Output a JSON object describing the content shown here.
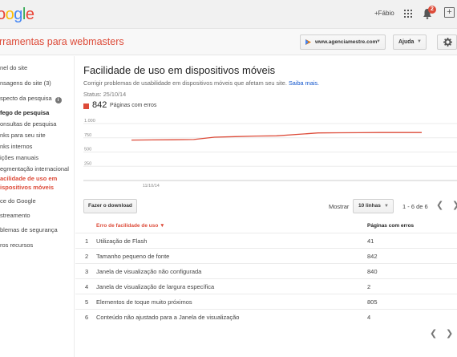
{
  "topbar": {
    "logo_visible": "ogle",
    "user_name": "+Fábio",
    "notification_count": "2"
  },
  "header": {
    "product_title": "rramentas para webmasters",
    "site_selector": "www.agenciamestre.com",
    "help_label": "Ajuda"
  },
  "sidebar": {
    "items": [
      "nel do site",
      "nsagens do site (3)",
      "specto da pesquisa",
      "fego de pesquisa",
      "onsultas de pesquisa",
      "nks para seu site",
      "nks internos",
      "ições manuais",
      "egmentação internacional",
      "acilidade de uso em",
      "ispositivos móveis",
      "ce do Google",
      "streamento",
      "blemas de segurança",
      "ros recursos"
    ]
  },
  "main": {
    "title": "Facilidade de uso em dispositivos móveis",
    "description": "Corrigir problemas de usabilidade em dispositivos móveis que afetam seu site.",
    "learn_more": "Saiba mais.",
    "status": "Status: 25/10/14",
    "legend_count": "842",
    "legend_label": "Páginas com erros",
    "download_label": "Fazer o download",
    "show_label": "Mostrar",
    "rows_select": "10 linhas",
    "range_text": "1 - 6 de 6",
    "col_error": "Erro de facilidade de uso",
    "col_count": "Páginas com erros",
    "rows": [
      {
        "num": "1",
        "name": "Utilização de Flash",
        "count": "41"
      },
      {
        "num": "2",
        "name": "Tamanho pequeno de fonte",
        "count": "842"
      },
      {
        "num": "3",
        "name": "Janela de visualização não configurada",
        "count": "840"
      },
      {
        "num": "4",
        "name": "Janela de visualização de largura específica",
        "count": "2"
      },
      {
        "num": "5",
        "name": "Elementos de toque muito próximos",
        "count": "805"
      },
      {
        "num": "6",
        "name": "Conteúdo não ajustado para a Janela de visualização",
        "count": "4"
      }
    ]
  },
  "chart_data": {
    "type": "line",
    "x": [
      "",
      "11/10/14",
      "",
      "",
      "",
      "",
      "",
      "",
      "",
      "",
      "",
      "",
      "",
      "",
      ""
    ],
    "series": [
      {
        "values": [
          710,
          712,
          715,
          720,
          760,
          770,
          780,
          785,
          810,
          835,
          838,
          840,
          842,
          842,
          842
        ]
      }
    ],
    "ytick_labels": [
      "1.000",
      "750",
      "500",
      "250"
    ],
    "ylim": [
      0,
      1000
    ],
    "line_color": "#dd4b39",
    "grid": true
  }
}
